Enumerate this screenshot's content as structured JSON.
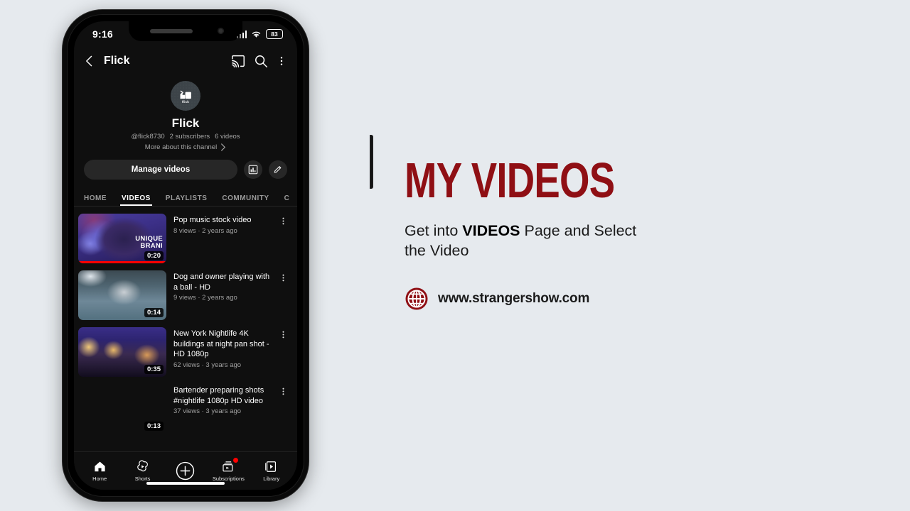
{
  "background_color": "#e6eaee",
  "phone": {
    "status_bar": {
      "time": "9:16",
      "battery_level": "83",
      "icons": [
        "signal-bars-icon",
        "wifi-icon",
        "battery-icon"
      ]
    },
    "app_header": {
      "back_icon": "back-chevron-icon",
      "title": "Flick",
      "cast_icon": "cast-icon",
      "search_icon": "search-icon",
      "overflow_icon": "more-vertical-icon"
    },
    "channel": {
      "avatar_label": "flick",
      "avatar_bg": "#3d4449",
      "name": "Flick",
      "handle": "@flick8730",
      "subscribers": "2 subscribers",
      "video_count": "6 videos",
      "more_about": "More about this channel",
      "manage_videos_label": "Manage videos",
      "analytics_icon": "analytics-bar-chart-icon",
      "edit_icon": "pencil-edit-icon"
    },
    "tabs": [
      {
        "label": "HOME",
        "active": false
      },
      {
        "label": "VIDEOS",
        "active": true
      },
      {
        "label": "PLAYLISTS",
        "active": false
      },
      {
        "label": "COMMUNITY",
        "active": false
      },
      {
        "label": "C",
        "active": false
      }
    ],
    "videos": [
      {
        "title": "Pop music stock video",
        "views": "8 views",
        "age": "2 years ago",
        "duration": "0:20",
        "progress_percent": 100,
        "thumb_overlay_line1": "UNIQUE",
        "thumb_overlay_line2": "BRANI",
        "thumb_style": "pop-music-purple"
      },
      {
        "title": "Dog and owner playing with a ball - HD",
        "views": "9 views",
        "age": "2 years ago",
        "duration": "0:14",
        "progress_percent": 0,
        "thumb_overlay_line1": "",
        "thumb_overlay_line2": "",
        "thumb_style": "dog-water-blue"
      },
      {
        "title": "New York Nightlife 4K buildings at night pan shot - HD 1080p",
        "views": "62 views",
        "age": "3 years ago",
        "duration": "0:35",
        "progress_percent": 0,
        "thumb_overlay_line1": "",
        "thumb_overlay_line2": "",
        "thumb_style": "nyc-skyline"
      },
      {
        "title": "Bartender preparing shots #nightlife 1080p HD video",
        "views": "37 views",
        "age": "3 years ago",
        "duration": "0:13",
        "progress_percent": 0,
        "thumb_overlay_line1": "",
        "thumb_overlay_line2": "",
        "thumb_style": "bartender-bar"
      }
    ],
    "bottom_nav": [
      {
        "label": "Home",
        "icon": "home-icon",
        "badge": false
      },
      {
        "label": "Shorts",
        "icon": "shorts-icon",
        "badge": false
      },
      {
        "label": "",
        "icon": "create-plus-icon",
        "badge": false
      },
      {
        "label": "Subscriptions",
        "icon": "subscriptions-icon",
        "badge": true
      },
      {
        "label": "Library",
        "icon": "library-icon",
        "badge": false
      }
    ]
  },
  "right_panel": {
    "headline": "MY VIDEOS",
    "headline_color": "#8f0f14",
    "subtext_before": "Get into ",
    "subtext_bold": "VIDEOS",
    "subtext_after": " Page and Select the Video",
    "globe_icon": "globe-icon",
    "url": "www.strangershow.com"
  }
}
